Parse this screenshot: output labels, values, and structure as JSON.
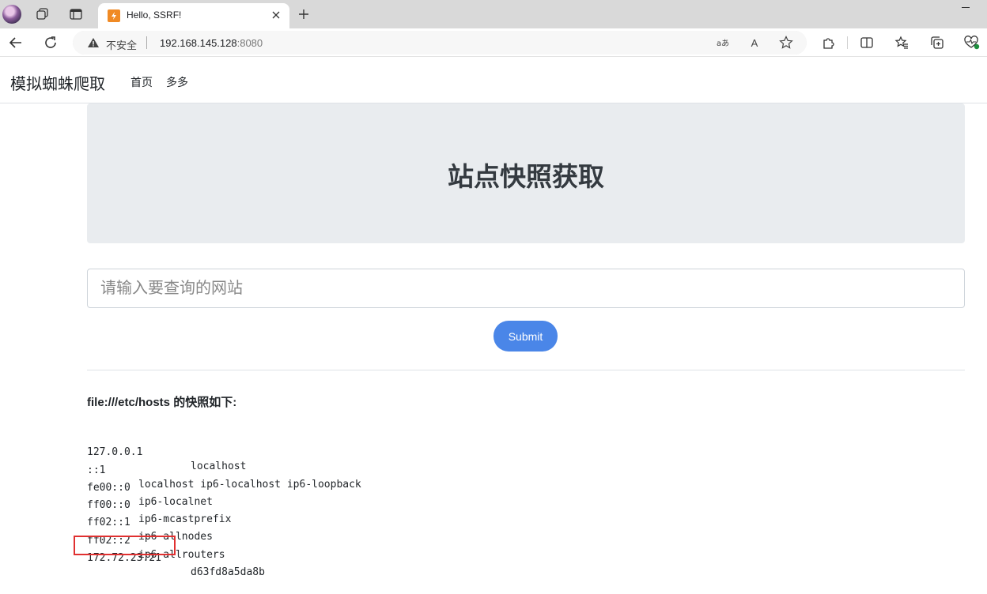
{
  "browser": {
    "tab_title": "Hello, SSRF!",
    "security_label": "不安全",
    "url_host": "192.168.145.128",
    "url_port": ":8080",
    "read_aloud_label": "A"
  },
  "navbar": {
    "brand": "模拟蜘蛛爬取",
    "links": [
      "首页",
      "多多"
    ]
  },
  "jumbotron": {
    "title": "站点快照获取"
  },
  "form": {
    "placeholder": "请输入要查询的网站",
    "submit_label": "Submit"
  },
  "result": {
    "title": "file:///etc/hosts 的快照如下:",
    "lines": [
      {
        "ip": "127.0.0.1",
        "names": "localhost"
      },
      {
        "ip": "::1",
        "names": "localhost ip6-localhost ip6-loopback"
      },
      {
        "ip": "fe00::0",
        "names": "ip6-localnet"
      },
      {
        "ip": "ff00::0",
        "names": "ip6-mcastprefix"
      },
      {
        "ip": "ff02::1",
        "names": "ip6-allnodes"
      },
      {
        "ip": "ff02::2",
        "names": "ip6-allrouters"
      },
      {
        "ip": "172.72.23.21",
        "names": "d63fd8a5da8b"
      }
    ]
  },
  "colors": {
    "accent": "#4a86e8",
    "highlight": "#e03030",
    "jumbotron_bg": "#e9ecef"
  }
}
